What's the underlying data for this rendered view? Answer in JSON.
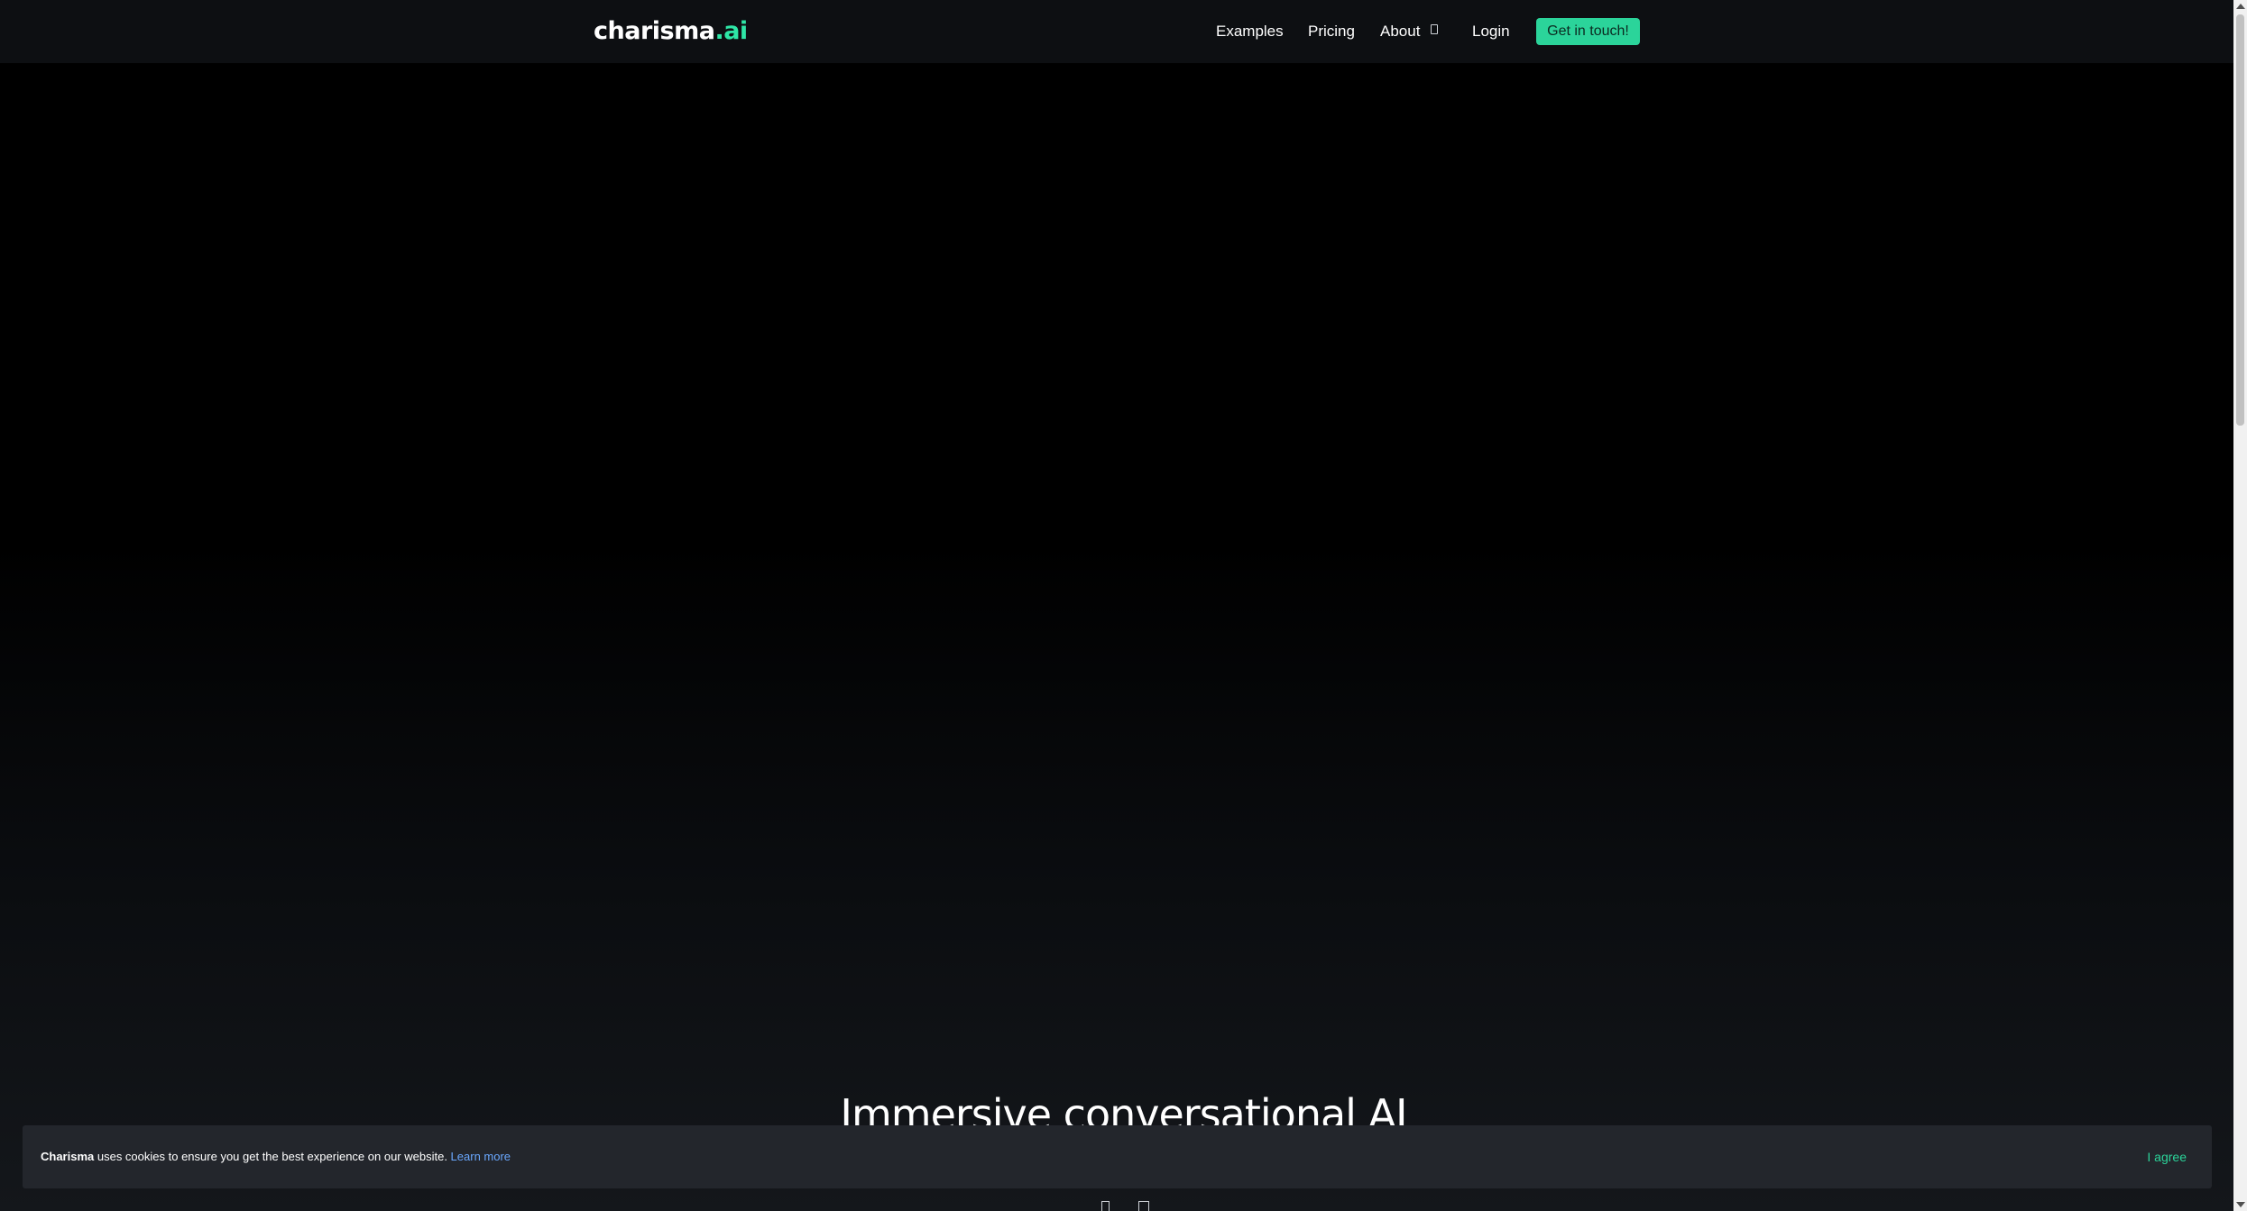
{
  "nav": {
    "logo_main": "charisma",
    "logo_suffix": ".ai",
    "links": {
      "examples": "Examples",
      "pricing": "Pricing",
      "about": "About",
      "login": "Login"
    },
    "cta": "Get in touch!"
  },
  "hero": {
    "title": "Immersive conversational AI"
  },
  "cookie": {
    "brand": "Charisma",
    "message": " uses cookies to ensure you get the best experience on our website. ",
    "learn_more": "Learn more",
    "agree": "I agree"
  },
  "colors": {
    "accent": "#2bd49a",
    "link": "#6aa8ff",
    "banner": "#23262c",
    "navbar": "#0d0f12"
  },
  "icons": {
    "about_caret": "chevron-down-icon",
    "bottom_left": "document-icon",
    "bottom_right": "grid-icon"
  }
}
